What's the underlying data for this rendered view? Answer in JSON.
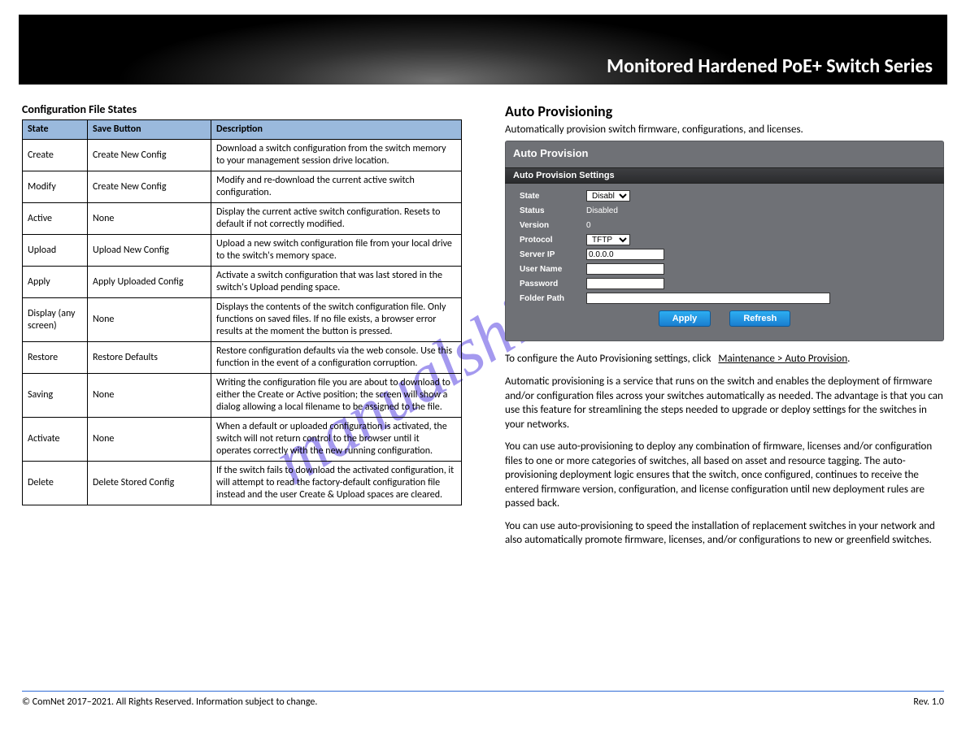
{
  "banner": {
    "title": "Monitored Hardened PoE+ Switch Series"
  },
  "watermark": "manualshive.com",
  "left": {
    "heading": "Configuration File States",
    "cols": [
      "State",
      "Save Button",
      "Description"
    ],
    "rows": [
      {
        "state": "Create",
        "btn": "Create New Config",
        "desc": "Download a switch configuration from the switch memory to your management session drive location."
      },
      {
        "state": "Modify",
        "btn": "Create New Config",
        "desc": "Modify and re-download the current active switch configuration."
      },
      {
        "state": "Active",
        "btn": "None",
        "desc": "Display the current active switch configuration. Resets to default if not correctly modified."
      },
      {
        "state": "Upload",
        "btn": "Upload New Config",
        "desc": "Upload a new switch configuration file from your local drive to the switch's memory space."
      },
      {
        "state": "Apply",
        "btn": "Apply Uploaded Config",
        "desc": "Activate a switch configuration that was last stored in the switch's Upload pending space."
      },
      {
        "state": "Display (any screen)",
        "btn": "None",
        "desc": "Displays the contents of the switch configuration file. Only functions on saved files. If no file exists, a browser error results at the moment the button is pressed."
      },
      {
        "state": "Restore",
        "btn": "Restore Defaults",
        "desc": "Restore configuration defaults via the web console. Use this function in the event of a configuration corruption."
      },
      {
        "state": "Saving",
        "btn": "None",
        "desc": "Writing the configuration file you are about to download to either the Create or Active position; the screen will show a dialog allowing a local filename to be assigned to the file."
      },
      {
        "state": "Activate",
        "btn": "None",
        "desc": "When a default or uploaded configuration is activated, the switch will not return control to the browser until it operates correctly with the new running configuration."
      },
      {
        "state": "Delete",
        "btn": "Delete Stored Config",
        "desc": "If the switch fails to download the activated configuration, it will attempt to read the factory-default configuration file instead and the user Create & Upload spaces are cleared."
      }
    ]
  },
  "right": {
    "title": "Auto Provisioning",
    "lead": "Automatically provision switch firmware, configurations, and licenses.",
    "nav": "To configure the Auto Provisioning settings, click",
    "path": "Maintenance > Auto Provision",
    "body1": "Automatic provisioning is a service that runs on the switch and enables the deployment of firmware and/or configuration files across your switches automatically as needed. The advantage is that you can use this feature for streamlining the steps needed to upgrade or deploy settings for the switches in your networks.",
    "body2": "You can use auto-provisioning to deploy any combination of firmware, licenses and/or configuration files to one or more categories of switches, all based on asset and resource tagging. The auto-provisioning deployment logic ensures that the switch, once configured, continues to receive the entered firmware version, configuration, and license configuration until new deployment rules are passed back.",
    "body3": "You can use auto-provisioning to speed the installation of replacement switches in your network and also automatically promote firmware, licenses, and/or configurations to new or greenfield switches."
  },
  "ui": {
    "panelTitle": "Auto Provision",
    "subTitle": "Auto Provision Settings",
    "labels": {
      "state": "State",
      "status": "Status",
      "version": "Version",
      "protocol": "Protocol",
      "serverip": "Server IP",
      "username": "User Name",
      "password": "Password",
      "folder": "Folder Path"
    },
    "values": {
      "state": "Disable",
      "status": "Disabled",
      "version": "0",
      "protocol": "TFTP",
      "serverip": "0.0.0.0",
      "username": "",
      "password": "",
      "folder": ""
    },
    "buttons": {
      "apply": "Apply",
      "refresh": "Refresh"
    }
  },
  "footer": {
    "left": "© ComNet 2017–2021. All Rights Reserved. Information subject to change.",
    "right": "Rev. 1.0"
  }
}
